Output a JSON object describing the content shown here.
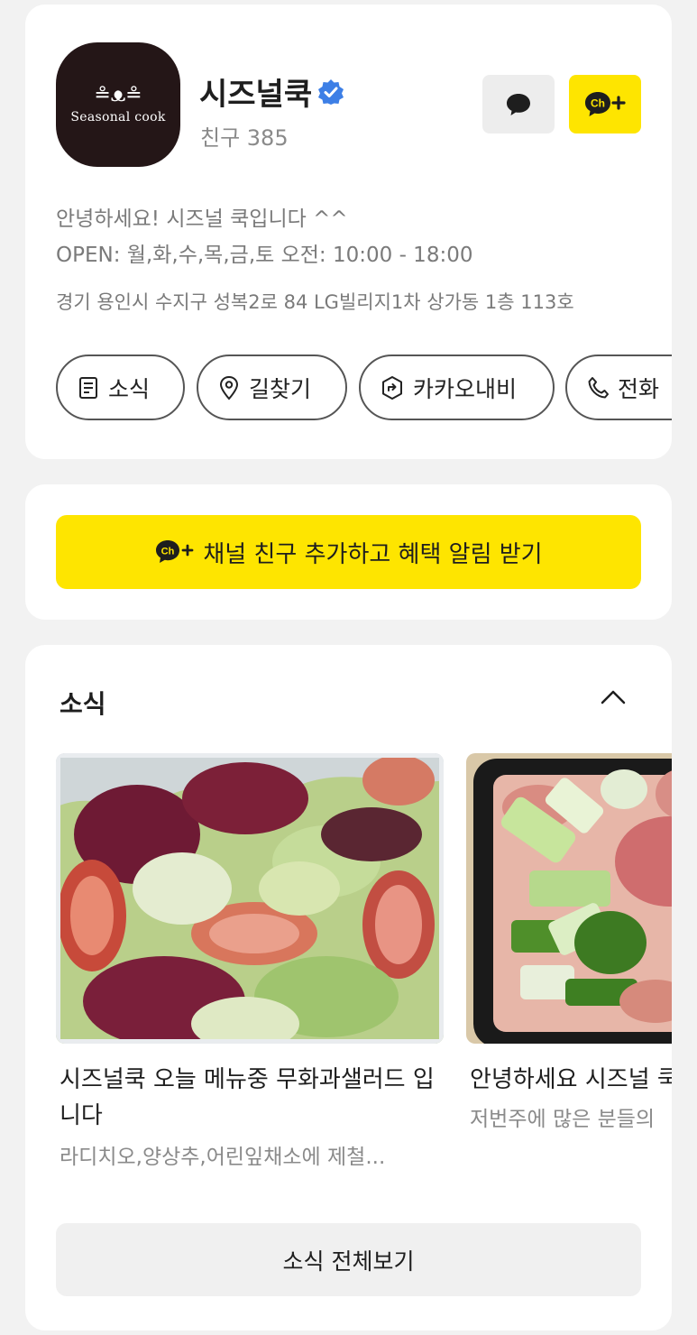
{
  "profile": {
    "logo_mark": "≗ᴥ≗",
    "logo_text": "Seasonal cook",
    "name": "시즈널쿡",
    "friends": "친구 385",
    "intro": "안녕하세요! 시즈널 쿡입니다 ^^",
    "hours": "OPEN: 월,화,수,목,금,토 오전: 10:00 - 18:00",
    "address": "경기 용인시 수지구 성복2로 84 LG빌리지1차 상가동 1층 113호",
    "actions": [
      {
        "label": "소식",
        "icon": "document-icon"
      },
      {
        "label": "길찾기",
        "icon": "map-pin-icon"
      },
      {
        "label": "카카오내비",
        "icon": "navigation-icon"
      },
      {
        "label": "전화",
        "icon": "phone-icon"
      }
    ]
  },
  "cta": {
    "badge": "Ch+",
    "label": "채널 친구 추가하고 혜택 알림 받기"
  },
  "news": {
    "section_title": "소식",
    "items": [
      {
        "title": "시즈널쿡 오늘 메뉴중 무화과샐러드 입니다",
        "subtitle": "라디치오,양상추,어린잎채소에 제철..."
      },
      {
        "title": "안녕하세요 시즈널 쿡",
        "subtitle": "저번주에 많은 분들의"
      }
    ],
    "view_all": "소식 전체보기"
  },
  "colors": {
    "kakao_yellow": "#fee500",
    "verified_blue": "#3d7fe6",
    "background": "#f2f2f2"
  }
}
